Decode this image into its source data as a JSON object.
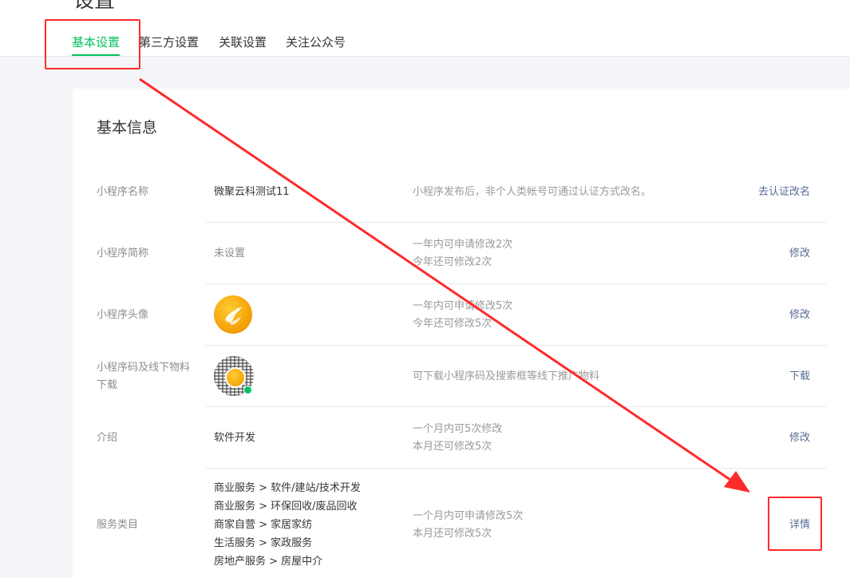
{
  "page": {
    "title": "设置"
  },
  "tabs": [
    {
      "label": "基本设置",
      "active": true
    },
    {
      "label": "第三方设置",
      "active": false
    },
    {
      "label": "关联设置",
      "active": false
    },
    {
      "label": "关注公众号",
      "active": false
    }
  ],
  "section": {
    "title": "基本信息"
  },
  "rows": {
    "name": {
      "label": "小程序名称",
      "value": "微聚云科测试11",
      "desc": "小程序发布后，非个人类帐号可通过认证方式改名。",
      "action": "去认证改名"
    },
    "short_name": {
      "label": "小程序简称",
      "value": "未设置",
      "desc_line1": "一年内可申请修改2次",
      "desc_line2": "今年还可修改2次",
      "action": "修改"
    },
    "avatar": {
      "label": "小程序头像",
      "desc_line1": "一年内可申请修改5次",
      "desc_line2": "今年还可修改5次",
      "action": "修改"
    },
    "qrcode": {
      "label_line1": "小程序码及线下物料",
      "label_line2": "下载",
      "desc": "可下载小程序码及搜索框等线下推广物料",
      "action": "下载"
    },
    "intro": {
      "label": "介绍",
      "value": "软件开发",
      "desc_line1": "一个月内可5次修改",
      "desc_line2": "本月还可修改5次",
      "action": "修改"
    },
    "category": {
      "label": "服务类目",
      "values": [
        "商业服务 > 软件/建站/技术开发",
        "商业服务 > 环保回收/废品回收",
        "商家自营 > 家居家纺",
        "生活服务 > 家政服务",
        "房地产服务 > 房屋中介"
      ],
      "desc_line1": "一个月内可申请修改5次",
      "desc_line2": "本月还可修改5次",
      "action": "详情"
    }
  },
  "colors": {
    "accent_green": "#07c160",
    "link_blue": "#576b95",
    "annotation_red": "#ff2b2b"
  },
  "icons": {
    "avatar": "phoenix-logo-icon",
    "qrcode": "mini-program-code-icon"
  }
}
